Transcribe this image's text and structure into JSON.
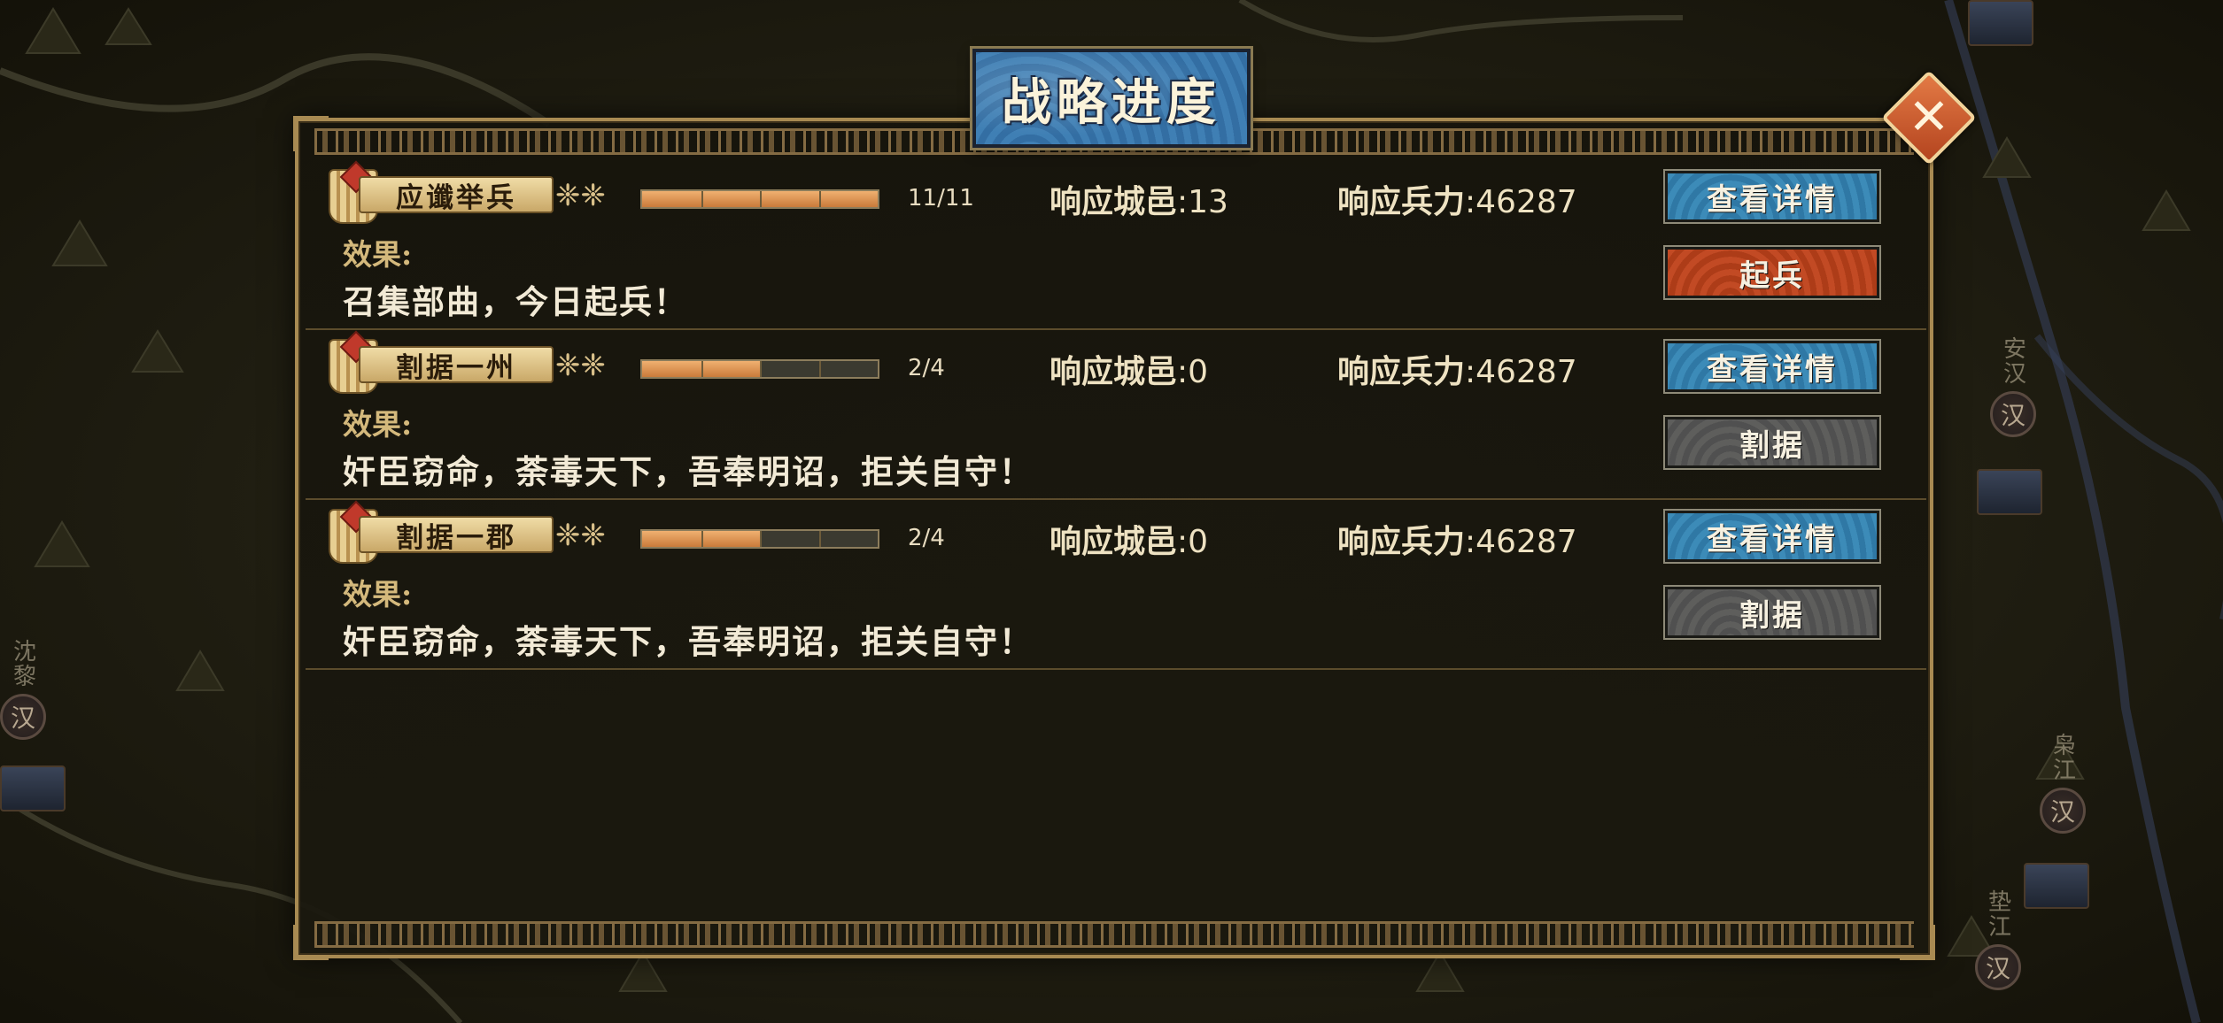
{
  "panel": {
    "title": "战略进度"
  },
  "quests": [
    {
      "name": "应谶举兵",
      "progress_text": "11/11",
      "progress": 1.0,
      "segments": 4,
      "cities_label": "响应城邑",
      "cities_value": ":13",
      "troops_label": "响应兵力",
      "troops_value": ":46287",
      "effect_label": "效果:",
      "effect_text": "召集部曲，今日起兵！",
      "detail_button": "查看详情",
      "action_button": "起兵",
      "action_style": "active"
    },
    {
      "name": "割据一州",
      "progress_text": "2/4",
      "progress": 0.5,
      "segments": 4,
      "cities_label": "响应城邑",
      "cities_value": ":0",
      "troops_label": "响应兵力",
      "troops_value": ":46287",
      "effect_label": "效果:",
      "effect_text": "奸臣窃命，荼毒天下，吾奉明诏，拒关自守！",
      "detail_button": "查看详情",
      "action_button": "割据",
      "action_style": "disabled"
    },
    {
      "name": "割据一郡",
      "progress_text": "2/4",
      "progress": 0.5,
      "segments": 4,
      "cities_label": "响应城邑",
      "cities_value": ":0",
      "troops_label": "响应兵力",
      "troops_value": ":46287",
      "effect_label": "效果:",
      "effect_text": "奸臣窃命，荼毒天下，吾奉明诏，拒关自守！",
      "detail_button": "查看详情",
      "action_button": "割据",
      "action_style": "disabled"
    }
  ],
  "map": {
    "cities": [
      {
        "name": "安汉",
        "badge": "汉"
      },
      {
        "name": "枭江",
        "badge": "汉"
      },
      {
        "name": "垫江",
        "badge": "汉"
      },
      {
        "name": "沈黎",
        "badge": "汉"
      }
    ]
  },
  "colors": {
    "detail_button": "#3c8bb8",
    "rise_button": "#c24a24",
    "split_button": "#5e5e5c",
    "progress_fill": "#e09a58",
    "panel_border": "#a88a52",
    "close_button": "#d0602f"
  },
  "icons": {
    "close": "close-icon",
    "banner": "flag-banner-icon",
    "knot": "cloud-knot-icon"
  }
}
